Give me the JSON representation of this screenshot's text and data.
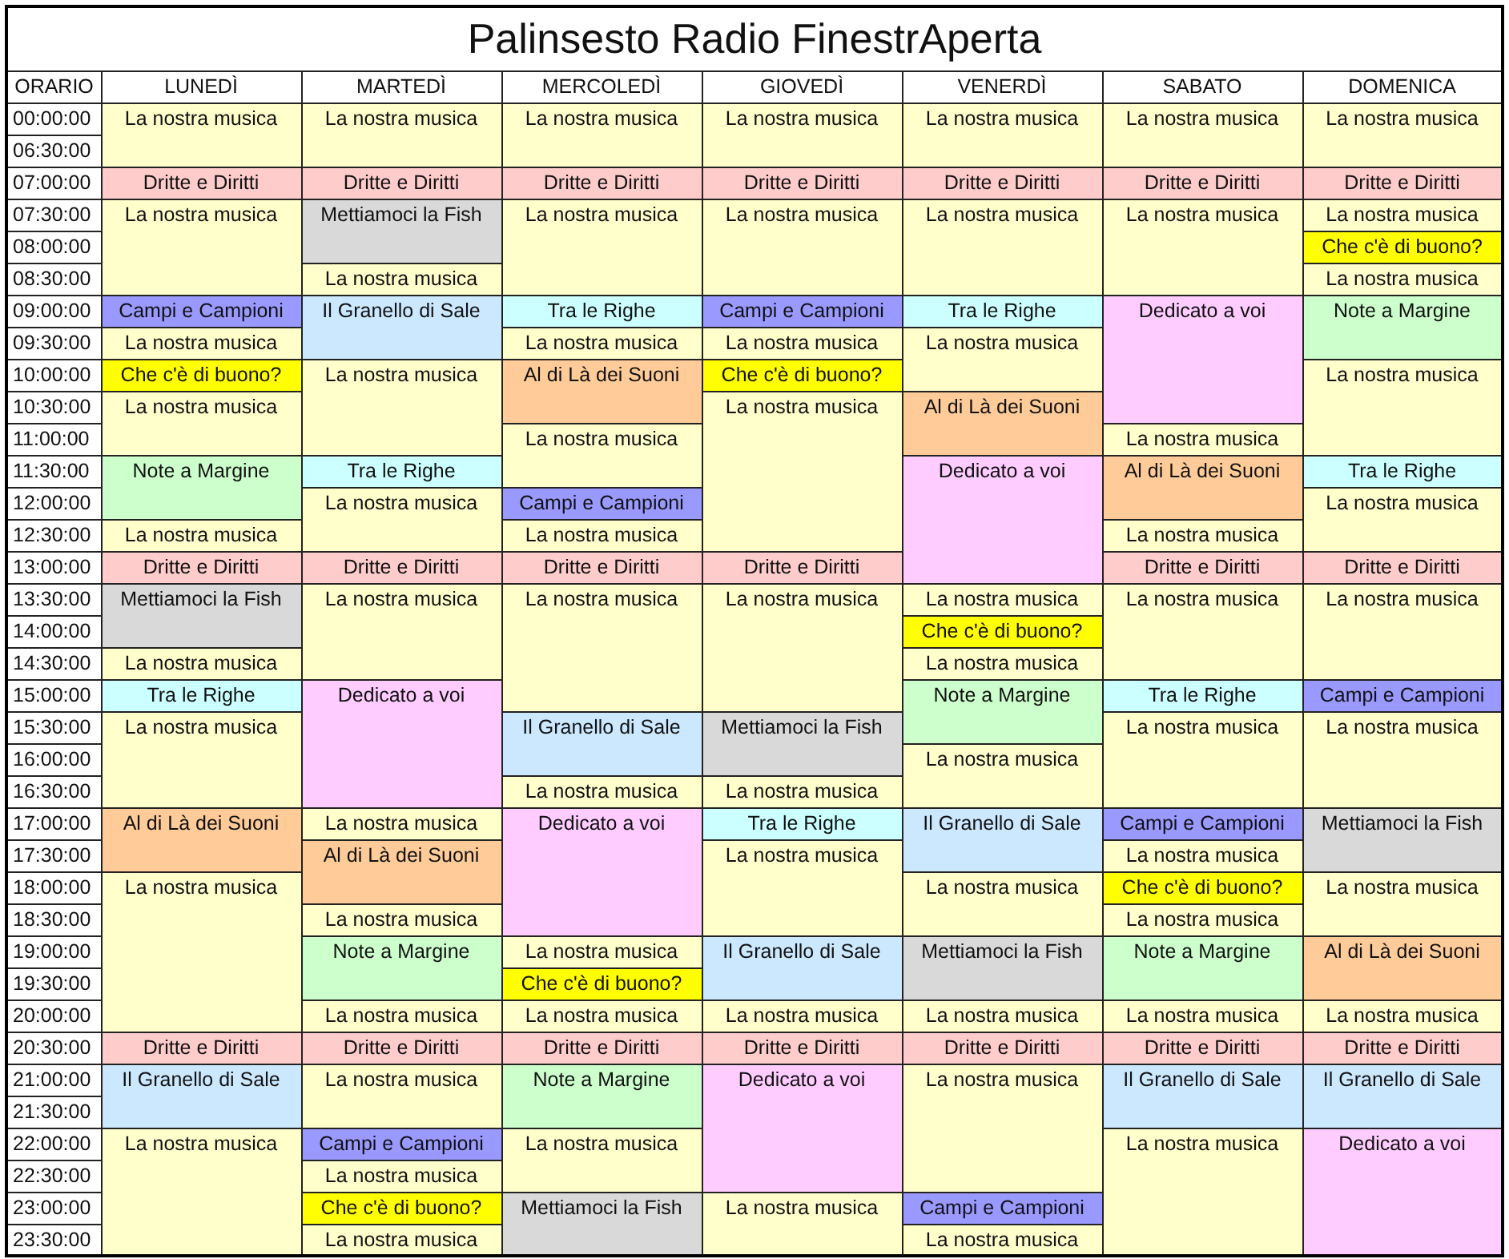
{
  "title": "Palinsesto Radio FinestrAperta",
  "columns": [
    "ORARIO",
    "LUNEDÌ",
    "MARTEDÌ",
    "MERCOLEDÌ",
    "GIOVEDÌ",
    "VENERDÌ",
    "SABATO",
    "DOMENICA"
  ],
  "times": [
    "00:00:00",
    "06:30:00",
    "07:00:00",
    "07:30:00",
    "08:00:00",
    "08:30:00",
    "09:00:00",
    "09:30:00",
    "10:00:00",
    "10:30:00",
    "11:00:00",
    "11:30:00",
    "12:00:00",
    "12:30:00",
    "13:00:00",
    "13:30:00",
    "14:00:00",
    "14:30:00",
    "15:00:00",
    "15:30:00",
    "16:00:00",
    "16:30:00",
    "17:00:00",
    "17:30:00",
    "18:00:00",
    "18:30:00",
    "19:00:00",
    "19:30:00",
    "20:00:00",
    "20:30:00",
    "21:00:00",
    "21:30:00",
    "22:00:00",
    "22:30:00",
    "23:00:00",
    "23:30:00"
  ],
  "days": [
    {
      "slots": [
        {
          "text": "La nostra musica",
          "color": "#ffffcc"
        },
        {
          "merged": true
        },
        {
          "text": "Dritte e Diritti",
          "color": "#ffcccc"
        },
        {
          "text": "La nostra musica",
          "color": "#ffffcc"
        },
        {
          "merged": true
        },
        {
          "merged": true
        },
        {
          "text": "Campi e Campioni",
          "color": "#9999ff"
        },
        {
          "text": "La nostra musica",
          "color": "#ffffcc"
        },
        {
          "text": "Che c'è di buono?",
          "color": "#ffff00"
        },
        {
          "text": "La nostra musica",
          "color": "#ffffcc"
        },
        {
          "merged": true
        },
        {
          "text": "Note a Margine",
          "color": "#ccffcc"
        },
        {
          "merged": true
        },
        {
          "text": "La nostra musica",
          "color": "#ffffcc"
        },
        {
          "text": "Dritte e Diritti",
          "color": "#ffcccc"
        },
        {
          "text": "Mettiamoci la Fish",
          "color": "#d9d9d9"
        },
        {
          "merged": true
        },
        {
          "text": "La nostra musica",
          "color": "#ffffcc"
        },
        {
          "text": "Tra le Righe",
          "color": "#ccffff"
        },
        {
          "text": "La nostra musica",
          "color": "#ffffcc"
        },
        {
          "merged": true
        },
        {
          "merged": true
        },
        {
          "text": "Al di Là dei Suoni",
          "color": "#ffcc99"
        },
        {
          "merged": true
        },
        {
          "text": "La nostra musica",
          "color": "#ffffcc"
        },
        {
          "merged": true
        },
        {
          "merged": true
        },
        {
          "merged": true
        },
        {
          "merged": true
        },
        {
          "text": "Dritte e Diritti",
          "color": "#ffcccc"
        },
        {
          "text": "Il Granello di Sale",
          "color": "#cce8ff"
        },
        {
          "merged": true
        },
        {
          "text": "La nostra musica",
          "color": "#ffffcc"
        },
        {
          "merged": true
        },
        {
          "merged": true
        },
        {
          "merged": true
        }
      ]
    },
    {
      "slots": [
        {
          "text": "La nostra musica",
          "color": "#ffffcc"
        },
        {
          "merged": true
        },
        {
          "text": "Dritte e Diritti",
          "color": "#ffcccc"
        },
        {
          "text": "Mettiamoci la Fish",
          "color": "#d9d9d9"
        },
        {
          "merged": true
        },
        {
          "text": "La nostra musica",
          "color": "#ffffcc"
        },
        {
          "text": "Il Granello di Sale",
          "color": "#cce8ff"
        },
        {
          "merged": true
        },
        {
          "text": "La nostra musica",
          "color": "#ffffcc"
        },
        {
          "merged": true
        },
        {
          "merged": true
        },
        {
          "text": "Tra le Righe",
          "color": "#ccffff"
        },
        {
          "text": "La nostra musica",
          "color": "#ffffcc"
        },
        {
          "merged": true
        },
        {
          "text": "Dritte e Diritti",
          "color": "#ffcccc"
        },
        {
          "text": "La nostra musica",
          "color": "#ffffcc"
        },
        {
          "merged": true
        },
        {
          "merged": true
        },
        {
          "text": "Dedicato a voi",
          "color": "#ffccff"
        },
        {
          "merged": true
        },
        {
          "merged": true
        },
        {
          "merged": true
        },
        {
          "text": "La nostra musica",
          "color": "#ffffcc"
        },
        {
          "text": "Al di Là dei Suoni",
          "color": "#ffcc99"
        },
        {
          "merged": true
        },
        {
          "text": "La nostra musica",
          "color": "#ffffcc"
        },
        {
          "text": "Note a Margine",
          "color": "#ccffcc"
        },
        {
          "merged": true
        },
        {
          "text": "La nostra musica",
          "color": "#ffffcc"
        },
        {
          "text": "Dritte e Diritti",
          "color": "#ffcccc"
        },
        {
          "text": "La nostra musica",
          "color": "#ffffcc"
        },
        {
          "merged": true
        },
        {
          "text": "Campi e Campioni",
          "color": "#9999ff"
        },
        {
          "text": "La nostra musica",
          "color": "#ffffcc"
        },
        {
          "text": "Che c'è di buono?",
          "color": "#ffff00"
        },
        {
          "text": "La nostra musica",
          "color": "#ffffcc"
        }
      ]
    },
    {
      "slots": [
        {
          "text": "La nostra musica",
          "color": "#ffffcc"
        },
        {
          "merged": true
        },
        {
          "text": "Dritte e Diritti",
          "color": "#ffcccc"
        },
        {
          "text": "La nostra musica",
          "color": "#ffffcc"
        },
        {
          "merged": true
        },
        {
          "merged": true
        },
        {
          "text": "Tra le Righe",
          "color": "#ccffff"
        },
        {
          "text": "La nostra musica",
          "color": "#ffffcc"
        },
        {
          "text": "Al di Là dei Suoni",
          "color": "#ffcc99"
        },
        {
          "merged": true
        },
        {
          "text": "La nostra musica",
          "color": "#ffffcc"
        },
        {
          "merged": true
        },
        {
          "text": "Campi e Campioni",
          "color": "#9999ff"
        },
        {
          "text": "La nostra musica",
          "color": "#ffffcc"
        },
        {
          "text": "Dritte e Diritti",
          "color": "#ffcccc"
        },
        {
          "text": "La nostra musica",
          "color": "#ffffcc"
        },
        {
          "merged": true
        },
        {
          "merged": true
        },
        {
          "merged": true
        },
        {
          "text": "Il Granello di Sale",
          "color": "#cce8ff"
        },
        {
          "merged": true
        },
        {
          "text": "La nostra musica",
          "color": "#ffffcc"
        },
        {
          "text": "Dedicato a voi",
          "color": "#ffccff"
        },
        {
          "merged": true
        },
        {
          "merged": true
        },
        {
          "merged": true
        },
        {
          "text": "La nostra musica",
          "color": "#ffffcc"
        },
        {
          "text": "Che c'è di buono?",
          "color": "#ffff00"
        },
        {
          "text": "La nostra musica",
          "color": "#ffffcc"
        },
        {
          "text": "Dritte e Diritti",
          "color": "#ffcccc"
        },
        {
          "text": "Note a Margine",
          "color": "#ccffcc"
        },
        {
          "merged": true
        },
        {
          "text": "La nostra musica",
          "color": "#ffffcc"
        },
        {
          "merged": true
        },
        {
          "text": "Mettiamoci la Fish",
          "color": "#d9d9d9"
        },
        {
          "merged": true
        }
      ]
    },
    {
      "slots": [
        {
          "text": "La nostra musica",
          "color": "#ffffcc"
        },
        {
          "merged": true
        },
        {
          "text": "Dritte e Diritti",
          "color": "#ffcccc"
        },
        {
          "text": "La nostra musica",
          "color": "#ffffcc"
        },
        {
          "merged": true
        },
        {
          "merged": true
        },
        {
          "text": "Campi e Campioni",
          "color": "#9999ff"
        },
        {
          "text": "La nostra musica",
          "color": "#ffffcc"
        },
        {
          "text": "Che c'è di buono?",
          "color": "#ffff00"
        },
        {
          "text": "La nostra musica",
          "color": "#ffffcc"
        },
        {
          "merged": true
        },
        {
          "merged": true
        },
        {
          "merged": true
        },
        {
          "merged": true
        },
        {
          "text": "Dritte e Diritti",
          "color": "#ffcccc"
        },
        {
          "text": "La nostra musica",
          "color": "#ffffcc"
        },
        {
          "merged": true
        },
        {
          "merged": true
        },
        {
          "merged": true
        },
        {
          "text": "Mettiamoci la Fish",
          "color": "#d9d9d9"
        },
        {
          "merged": true
        },
        {
          "text": "La nostra musica",
          "color": "#ffffcc"
        },
        {
          "text": "Tra le Righe",
          "color": "#ccffff"
        },
        {
          "text": "La nostra musica",
          "color": "#ffffcc"
        },
        {
          "merged": true
        },
        {
          "merged": true
        },
        {
          "text": "Il Granello di Sale",
          "color": "#cce8ff"
        },
        {
          "merged": true
        },
        {
          "text": "La nostra musica",
          "color": "#ffffcc"
        },
        {
          "text": "Dritte e Diritti",
          "color": "#ffcccc"
        },
        {
          "text": "Dedicato a voi",
          "color": "#ffccff"
        },
        {
          "merged": true
        },
        {
          "merged": true
        },
        {
          "merged": true
        },
        {
          "text": "La nostra musica",
          "color": "#ffffcc"
        },
        {
          "merged": true
        }
      ]
    },
    {
      "slots": [
        {
          "text": "La nostra musica",
          "color": "#ffffcc"
        },
        {
          "merged": true
        },
        {
          "text": "Dritte e Diritti",
          "color": "#ffcccc"
        },
        {
          "text": "La nostra musica",
          "color": "#ffffcc"
        },
        {
          "merged": true
        },
        {
          "merged": true
        },
        {
          "text": "Tra le Righe",
          "color": "#ccffff"
        },
        {
          "text": "La nostra musica",
          "color": "#ffffcc"
        },
        {
          "merged": true
        },
        {
          "text": "Al di Là dei Suoni",
          "color": "#ffcc99"
        },
        {
          "merged": true
        },
        {
          "text": "Dedicato a voi",
          "color": "#ffccff"
        },
        {
          "merged": true
        },
        {
          "merged": true
        },
        {
          "merged": true
        },
        {
          "text": "La nostra musica",
          "color": "#ffffcc"
        },
        {
          "text": "Che c'è di buono?",
          "color": "#ffff00"
        },
        {
          "text": "La nostra musica",
          "color": "#ffffcc"
        },
        {
          "text": "Note a Margine",
          "color": "#ccffcc"
        },
        {
          "merged": true
        },
        {
          "text": "La nostra musica",
          "color": "#ffffcc"
        },
        {
          "merged": true
        },
        {
          "text": "Il Granello di Sale",
          "color": "#cce8ff"
        },
        {
          "merged": true
        },
        {
          "text": "La nostra musica",
          "color": "#ffffcc"
        },
        {
          "merged": true
        },
        {
          "text": "Mettiamoci la Fish",
          "color": "#d9d9d9"
        },
        {
          "merged": true
        },
        {
          "text": "La nostra musica",
          "color": "#ffffcc"
        },
        {
          "text": "Dritte e Diritti",
          "color": "#ffcccc"
        },
        {
          "text": "La nostra musica",
          "color": "#ffffcc"
        },
        {
          "merged": true
        },
        {
          "merged": true
        },
        {
          "merged": true
        },
        {
          "text": "Campi e Campioni",
          "color": "#9999ff"
        },
        {
          "text": "La nostra musica",
          "color": "#ffffcc"
        }
      ]
    },
    {
      "slots": [
        {
          "text": "La nostra musica",
          "color": "#ffffcc"
        },
        {
          "merged": true
        },
        {
          "text": "Dritte e Diritti",
          "color": "#ffcccc"
        },
        {
          "text": "La nostra musica",
          "color": "#ffffcc"
        },
        {
          "merged": true
        },
        {
          "merged": true
        },
        {
          "text": "Dedicato a voi",
          "color": "#ffccff"
        },
        {
          "merged": true
        },
        {
          "merged": true
        },
        {
          "merged": true
        },
        {
          "text": "La nostra musica",
          "color": "#ffffcc"
        },
        {
          "text": "Al di Là dei Suoni",
          "color": "#ffcc99"
        },
        {
          "merged": true
        },
        {
          "text": "La nostra musica",
          "color": "#ffffcc"
        },
        {
          "text": "Dritte e Diritti",
          "color": "#ffcccc"
        },
        {
          "text": "La nostra musica",
          "color": "#ffffcc"
        },
        {
          "merged": true
        },
        {
          "merged": true
        },
        {
          "text": "Tra le Righe",
          "color": "#ccffff"
        },
        {
          "text": "La nostra musica",
          "color": "#ffffcc"
        },
        {
          "merged": true
        },
        {
          "merged": true
        },
        {
          "text": "Campi e Campioni",
          "color": "#9999ff"
        },
        {
          "text": "La nostra musica",
          "color": "#ffffcc"
        },
        {
          "text": "Che c'è di buono?",
          "color": "#ffff00"
        },
        {
          "text": "La nostra musica",
          "color": "#ffffcc"
        },
        {
          "text": "Note a Margine",
          "color": "#ccffcc"
        },
        {
          "merged": true
        },
        {
          "text": "La nostra musica",
          "color": "#ffffcc"
        },
        {
          "text": "Dritte e Diritti",
          "color": "#ffcccc"
        },
        {
          "text": "Il Granello di Sale",
          "color": "#cce8ff"
        },
        {
          "merged": true
        },
        {
          "text": "La nostra musica",
          "color": "#ffffcc"
        },
        {
          "merged": true
        },
        {
          "merged": true
        },
        {
          "merged": true
        }
      ]
    },
    {
      "slots": [
        {
          "text": "La nostra musica",
          "color": "#ffffcc"
        },
        {
          "merged": true
        },
        {
          "text": "Dritte e Diritti",
          "color": "#ffcccc"
        },
        {
          "text": "La nostra musica",
          "color": "#ffffcc"
        },
        {
          "text": "Che c'è di buono?",
          "color": "#ffff00"
        },
        {
          "text": "La nostra musica",
          "color": "#ffffcc"
        },
        {
          "text": "Note a Margine",
          "color": "#ccffcc"
        },
        {
          "merged": true
        },
        {
          "text": "La nostra musica",
          "color": "#ffffcc"
        },
        {
          "merged": true
        },
        {
          "merged": true
        },
        {
          "text": "Tra le Righe",
          "color": "#ccffff"
        },
        {
          "text": "La nostra musica",
          "color": "#ffffcc"
        },
        {
          "merged": true
        },
        {
          "text": "Dritte e Diritti",
          "color": "#ffcccc"
        },
        {
          "text": "La nostra musica",
          "color": "#ffffcc"
        },
        {
          "merged": true
        },
        {
          "merged": true
        },
        {
          "text": "Campi e Campioni",
          "color": "#9999ff"
        },
        {
          "text": "La nostra musica",
          "color": "#ffffcc"
        },
        {
          "merged": true
        },
        {
          "merged": true
        },
        {
          "text": "Mettiamoci la Fish",
          "color": "#d9d9d9"
        },
        {
          "merged": true
        },
        {
          "text": "La nostra musica",
          "color": "#ffffcc"
        },
        {
          "merged": true
        },
        {
          "text": "Al di Là dei Suoni",
          "color": "#ffcc99"
        },
        {
          "merged": true
        },
        {
          "text": "La nostra musica",
          "color": "#ffffcc"
        },
        {
          "text": "Dritte e Diritti",
          "color": "#ffcccc"
        },
        {
          "text": "Il Granello di Sale",
          "color": "#cce8ff"
        },
        {
          "merged": true
        },
        {
          "text": "Dedicato a voi",
          "color": "#ffccff"
        },
        {
          "merged": true
        },
        {
          "merged": true
        },
        {
          "merged": true
        }
      ]
    }
  ]
}
